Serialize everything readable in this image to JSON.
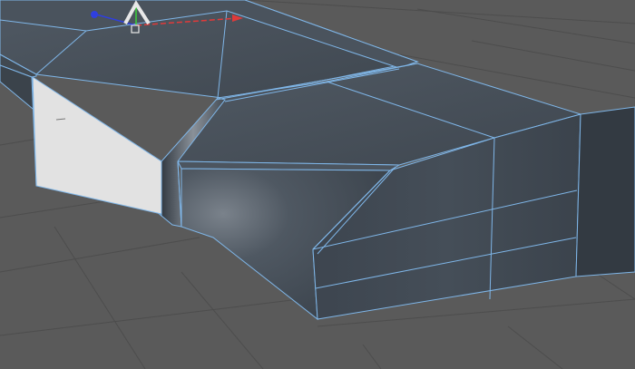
{
  "viewport": {
    "background_color": "#5a5a5a",
    "grid_color": "#4c4c4c",
    "grid_major_color": "#474747"
  },
  "model": {
    "face_top_color": "#49525c",
    "face_front_color": "#404953",
    "face_dark_color": "#353c45",
    "face_white_color": "#e2e2e2",
    "wire_color": "#7fb6e8",
    "highlight_color": "#8c939b"
  },
  "gizmo": {
    "x_axis_color": "#e03a3a",
    "y_axis_color": "#3ad23a",
    "z_axis_color": "#2f3fe0",
    "tool_icon": "move-tool-icon",
    "tool_color": "#e8e8e8"
  }
}
